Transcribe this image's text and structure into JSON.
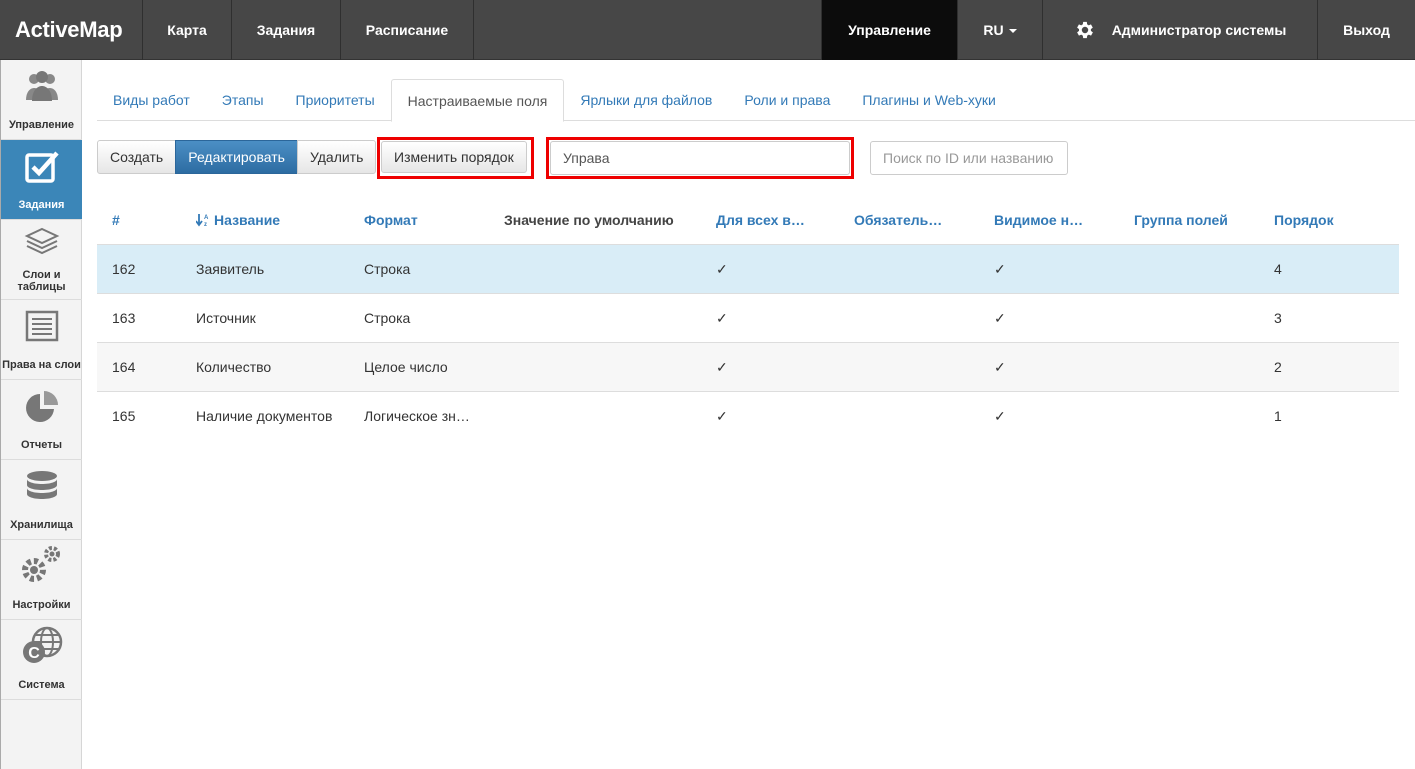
{
  "topbar": {
    "brand": "ActiveMap",
    "nav": [
      "Карта",
      "Задания",
      "Расписание"
    ],
    "admin_nav": "Управление",
    "lang": "RU",
    "user": "Администратор системы",
    "logout": "Выход"
  },
  "sidebar": {
    "items": [
      {
        "label": "Управление",
        "icon": "users-icon"
      },
      {
        "label": "Задания",
        "icon": "checkbox-icon"
      },
      {
        "label": "Слои и таблицы",
        "icon": "layers-icon"
      },
      {
        "label": "Права на слои",
        "icon": "list-icon"
      },
      {
        "label": "Отчеты",
        "icon": "pie-chart-icon"
      },
      {
        "label": "Хранилища",
        "icon": "database-icon"
      },
      {
        "label": "Настройки",
        "icon": "gears-icon"
      },
      {
        "label": "Система",
        "icon": "globe-icon"
      }
    ]
  },
  "tabs": [
    "Виды работ",
    "Этапы",
    "Приоритеты",
    "Настраиваемые поля",
    "Ярлыки для файлов",
    "Роли и права",
    "Плагины и Web-хуки"
  ],
  "toolbar": {
    "create": "Создать",
    "edit": "Редактировать",
    "delete": "Удалить",
    "reorder": "Изменить порядок"
  },
  "group_field": {
    "value": "Управа"
  },
  "search": {
    "placeholder": "Поиск по ID или названию"
  },
  "table": {
    "headers": [
      "#",
      "Название",
      "Формат",
      "Значение по умолчанию",
      "Для всех в…",
      "Обязатель…",
      "Видимое н…",
      "Группа полей",
      "Порядок"
    ],
    "rows": [
      {
        "id": "162",
        "name": "Заявитель",
        "format": "Строка",
        "default": "",
        "all": "✓",
        "required": "",
        "visible": "✓",
        "group": "",
        "order": "4"
      },
      {
        "id": "163",
        "name": "Источник",
        "format": "Строка",
        "default": "",
        "all": "✓",
        "required": "",
        "visible": "✓",
        "group": "",
        "order": "3"
      },
      {
        "id": "164",
        "name": "Количество",
        "format": "Целое число",
        "default": "",
        "all": "✓",
        "required": "",
        "visible": "✓",
        "group": "",
        "order": "2"
      },
      {
        "id": "165",
        "name": "Наличие документов",
        "format": "Логическое зн…",
        "default": "",
        "all": "✓",
        "required": "",
        "visible": "✓",
        "group": "",
        "order": "1"
      }
    ]
  },
  "colors": {
    "accent": "#337ab7",
    "selected_row": "#d9edf7",
    "highlight": "#ee0000",
    "sidebar_active": "#3b86b8"
  }
}
